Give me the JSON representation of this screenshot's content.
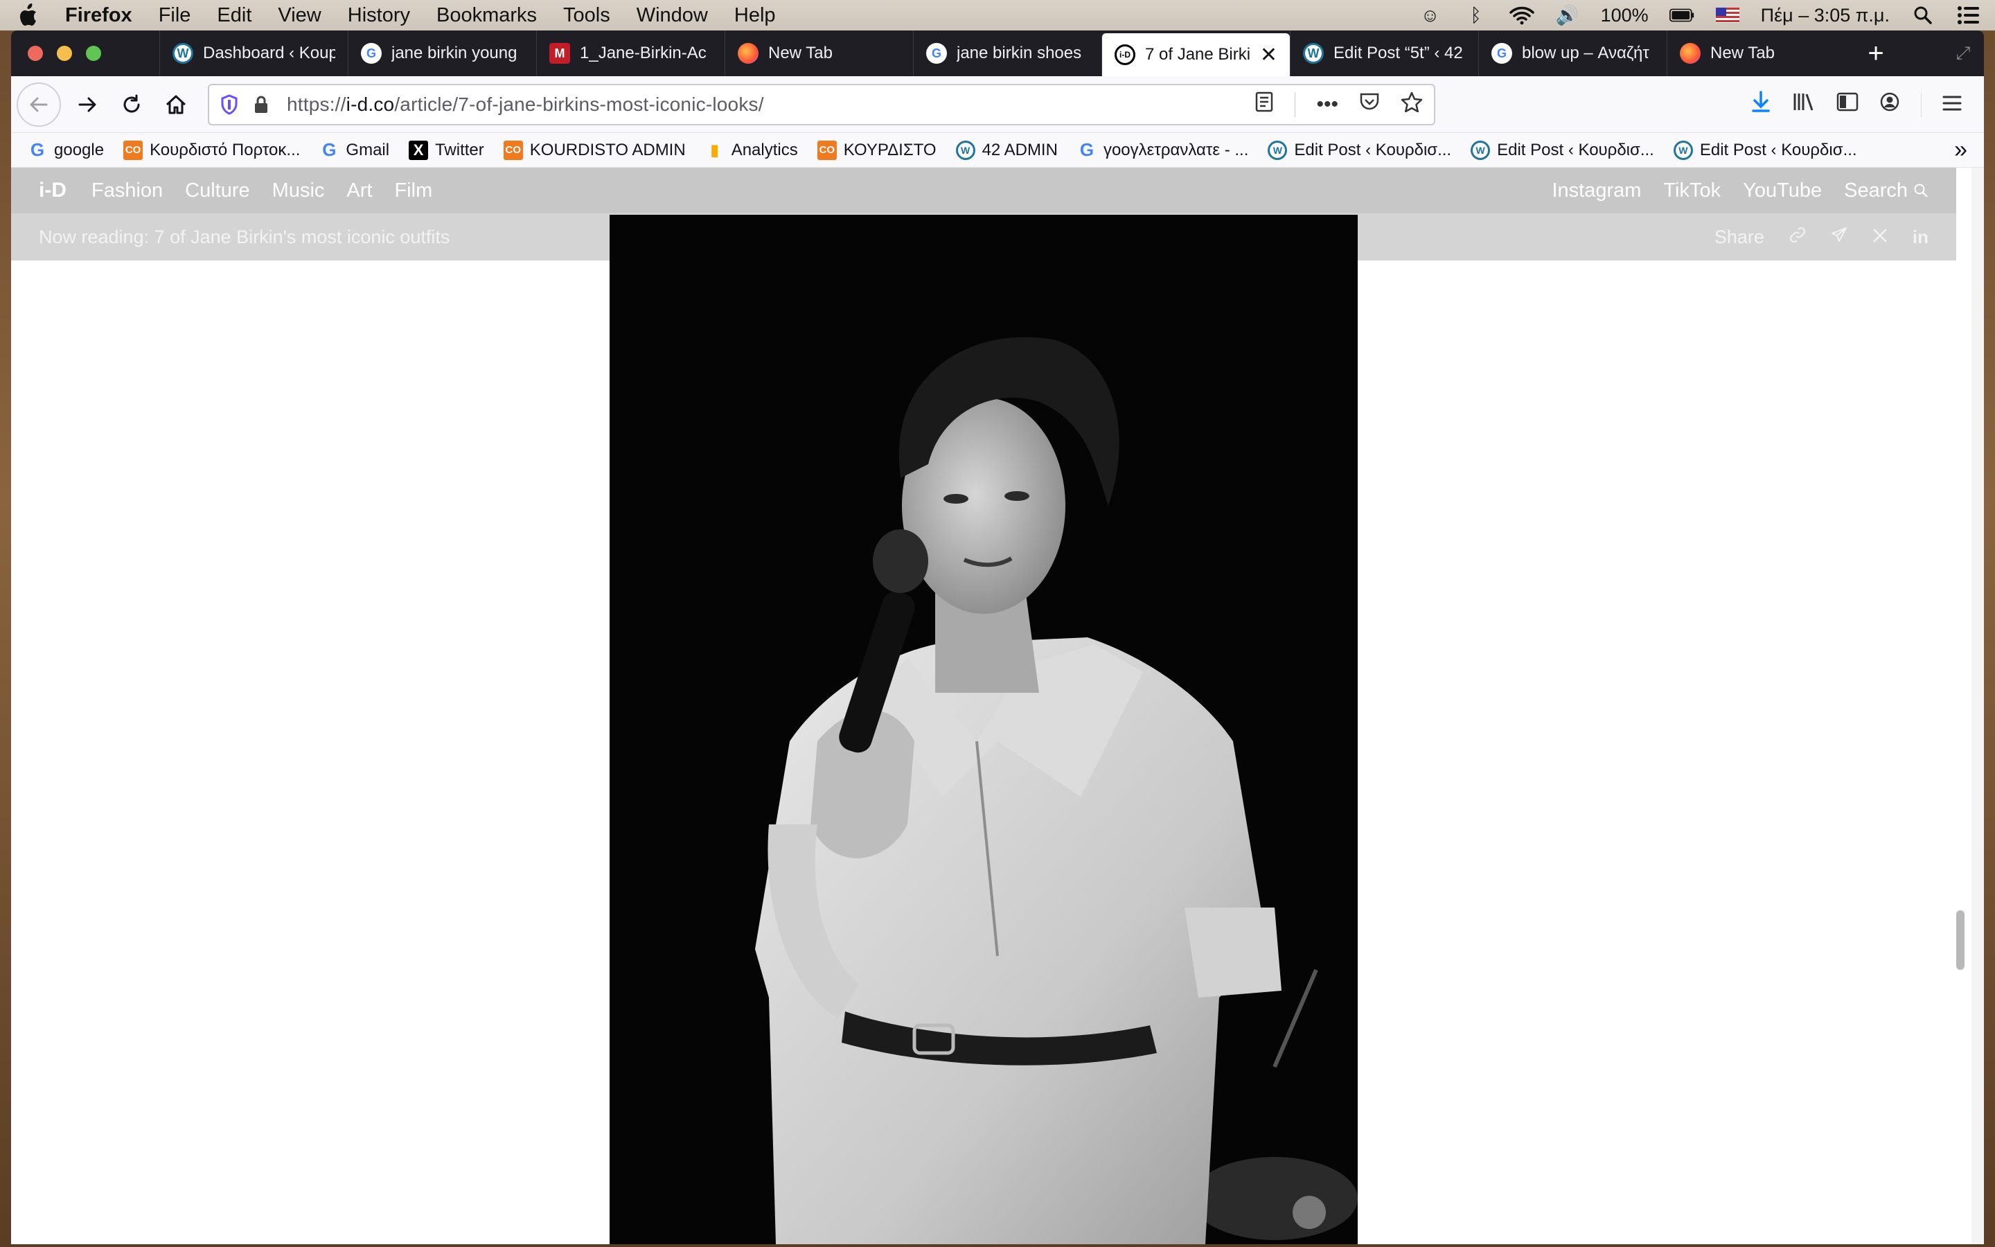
{
  "os_menubar": {
    "app": "Firefox",
    "menus": [
      "File",
      "Edit",
      "View",
      "History",
      "Bookmarks",
      "Tools",
      "Window",
      "Help"
    ],
    "battery": "100%",
    "clock": "Πέμ – 3:05 π.μ."
  },
  "tabs": [
    {
      "title": "Dashboard ‹ Koup",
      "icon": "wordpress-icon",
      "fav": "W",
      "kind": "wp"
    },
    {
      "title": "jane birkin young",
      "icon": "google-icon",
      "fav": "G",
      "kind": "goog"
    },
    {
      "title": "1_Jane-Birkin-Ac",
      "icon": "m-icon",
      "fav": "M",
      "kind": "m"
    },
    {
      "title": "New Tab",
      "icon": "firefox-icon",
      "fav": "",
      "kind": "ff"
    },
    {
      "title": "jane birkin shoes",
      "icon": "google-icon",
      "fav": "G",
      "kind": "goog"
    },
    {
      "title": "7 of Jane Birki",
      "icon": "id-icon",
      "fav": "i-D",
      "kind": "id",
      "active": true
    },
    {
      "title": "Edit Post “5t” ‹ 42",
      "icon": "wordpress-icon",
      "fav": "W",
      "kind": "wp"
    },
    {
      "title": "blow up – Αναζήτ",
      "icon": "google-icon",
      "fav": "G",
      "kind": "goog"
    },
    {
      "title": "New Tab",
      "icon": "firefox-icon",
      "fav": "",
      "kind": "ff"
    }
  ],
  "address": {
    "prefix": "https://",
    "host": "i-d.co",
    "path": "/article/7-of-jane-birkins-most-iconic-looks/"
  },
  "bookmarks": [
    {
      "label": "google",
      "icon": "google-icon",
      "glyph": "G",
      "kind": "g"
    },
    {
      "label": "Κουρδιστό Πορτοκ...",
      "icon": "co-icon",
      "glyph": "CO",
      "kind": "co"
    },
    {
      "label": "Gmail",
      "icon": "google-icon",
      "glyph": "G",
      "kind": "g"
    },
    {
      "label": "Twitter",
      "icon": "x-icon",
      "glyph": "X",
      "kind": "x"
    },
    {
      "label": "KOURDISTO ADMIN",
      "icon": "co-icon",
      "glyph": "CO",
      "kind": "co"
    },
    {
      "label": "Analytics",
      "icon": "analytics-icon",
      "glyph": "▮",
      "kind": "an"
    },
    {
      "label": "ΚΟΥΡΔΙΣΤΟ",
      "icon": "co-icon",
      "glyph": "CO",
      "kind": "co"
    },
    {
      "label": "42 ADMIN",
      "icon": "wordpress-icon",
      "glyph": "W",
      "kind": "wp"
    },
    {
      "label": "γοογλετρανλατε - ...",
      "icon": "google-icon",
      "glyph": "G",
      "kind": "g"
    },
    {
      "label": "Edit Post ‹ Κουρδισ...",
      "icon": "wordpress-icon",
      "glyph": "W",
      "kind": "wp"
    },
    {
      "label": "Edit Post ‹ Κουρδισ...",
      "icon": "wordpress-icon",
      "glyph": "W",
      "kind": "wp"
    },
    {
      "label": "Edit Post ‹ Κουρδισ...",
      "icon": "wordpress-icon",
      "glyph": "W",
      "kind": "wp"
    }
  ],
  "site": {
    "logo": "i-D",
    "nav": [
      "Fashion",
      "Culture",
      "Music",
      "Art",
      "Film"
    ],
    "right": [
      "Instagram",
      "TikTok",
      "YouTube",
      "Search"
    ],
    "now_reading": "Now reading: 7 of Jane Birkin's most iconic outfits",
    "share": "Share"
  },
  "colors": {
    "tabbar": "#1f1e25",
    "sitenav": "#c7c7c7",
    "download_accent": "#0a84ff"
  }
}
